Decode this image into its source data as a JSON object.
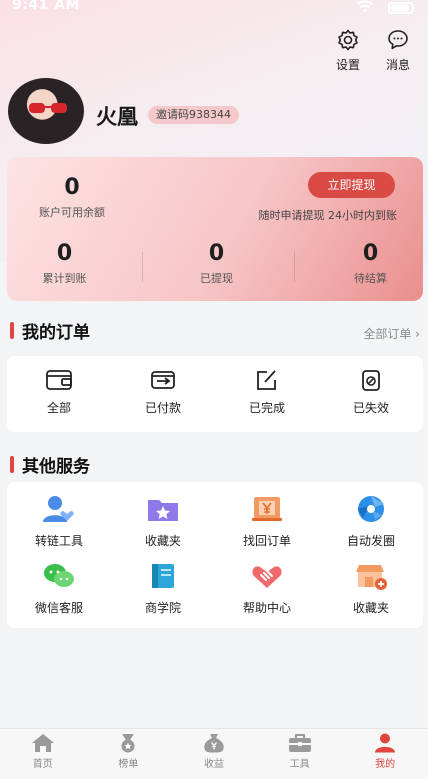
{
  "status_bar": {
    "time": "9:41 AM"
  },
  "top_actions": {
    "settings": "设置",
    "messages": "消息"
  },
  "profile": {
    "name": "火凰",
    "invite_code": "邀请码938344"
  },
  "wallet": {
    "available_balance": "0",
    "available_label": "账户可用余额",
    "withdraw_button": "立即提现",
    "withdraw_note": "随时申请提现 24小时内到账",
    "stats": [
      {
        "value": "0",
        "label": "累计到账"
      },
      {
        "value": "0",
        "label": "已提现"
      },
      {
        "value": "0",
        "label": "待结算"
      }
    ]
  },
  "orders": {
    "title": "我的订单",
    "all_link": "全部订单 ›",
    "items": [
      {
        "label": "全部",
        "icon": "wallet-icon"
      },
      {
        "label": "已付款",
        "icon": "paid-icon"
      },
      {
        "label": "已完成",
        "icon": "edit-icon"
      },
      {
        "label": "已失效",
        "icon": "invalid-icon"
      }
    ]
  },
  "services": {
    "title": "其他服务",
    "items": [
      {
        "label": "转链工具",
        "icon": "user-heart-icon"
      },
      {
        "label": "收藏夹",
        "icon": "folder-star-icon"
      },
      {
        "label": "找回订单",
        "icon": "order-yen-icon"
      },
      {
        "label": "自动发圈",
        "icon": "shutter-icon"
      },
      {
        "label": "微信客服",
        "icon": "wechat-icon"
      },
      {
        "label": "商学院",
        "icon": "book-icon"
      },
      {
        "label": "帮助中心",
        "icon": "handshake-icon"
      },
      {
        "label": "收藏夹",
        "icon": "shop-add-icon"
      }
    ]
  },
  "tabbar": [
    {
      "label": "首页",
      "icon": "home-icon"
    },
    {
      "label": "榜单",
      "icon": "medal-icon"
    },
    {
      "label": "收益",
      "icon": "money-bag-icon"
    },
    {
      "label": "工具",
      "icon": "toolbox-icon"
    },
    {
      "label": "我的",
      "icon": "user-icon",
      "active": true
    }
  ],
  "colors": {
    "accent": "#e0453f",
    "card_start": "#fde3e4",
    "card_end": "#e98f8d"
  }
}
